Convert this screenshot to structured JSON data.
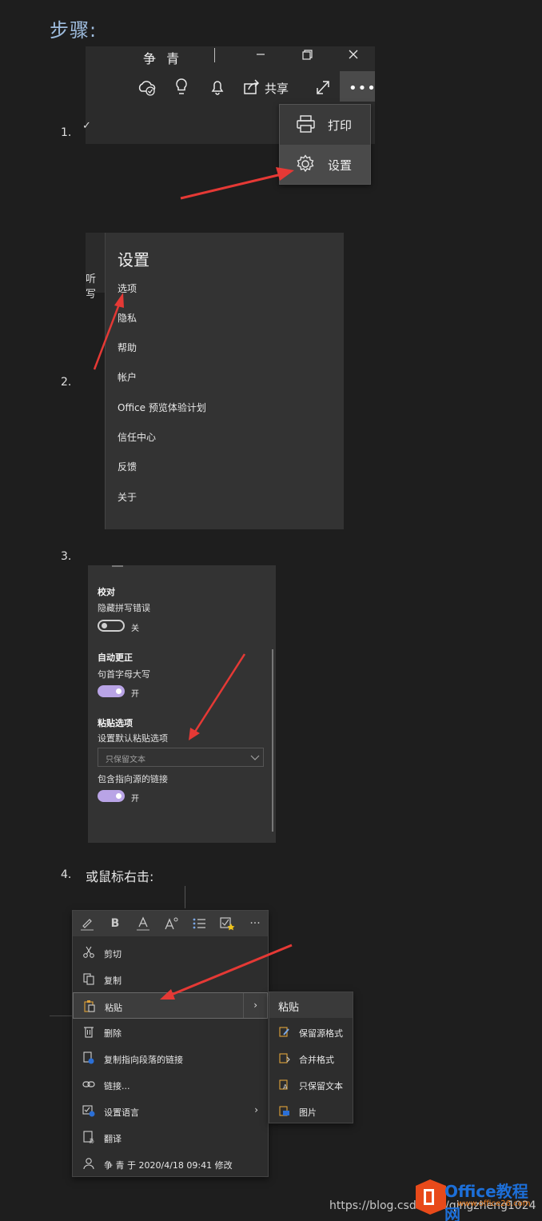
{
  "heading": "步骤:",
  "step_numbers": [
    "1.",
    "2.",
    "3.",
    "4."
  ],
  "step1": {
    "window_title": "争 青",
    "window_controls": [
      "minimize-icon",
      "restore-icon",
      "close-icon"
    ],
    "toolbar_icons": [
      "cloud-sync-icon",
      "lightbulb-icon",
      "bell-icon",
      "share-icon",
      "expand-icon",
      "more-icon"
    ],
    "share_label": "共享",
    "more_label": "•••",
    "fragment": "✓",
    "menu": [
      {
        "label": "打印",
        "icon": "printer-icon"
      },
      {
        "label": "设置",
        "icon": "gear-icon"
      }
    ]
  },
  "step2": {
    "left_fragment": "听写",
    "title": "设置",
    "items": [
      "选项",
      "隐私",
      "帮助",
      "帐户",
      "Office 预览体验计划",
      "信任中心",
      "反馈",
      "关于"
    ]
  },
  "step3": {
    "section1": {
      "title": "校对",
      "option": "隐藏拼写错误",
      "state": "关",
      "on": false
    },
    "section2": {
      "title": "自动更正",
      "option": "句首字母大写",
      "state": "开",
      "on": true
    },
    "section3": {
      "title": "粘贴选项",
      "dropdown_label": "设置默认粘贴选项",
      "dropdown_value": "只保留文本",
      "link_option": "包含指向源的链接",
      "link_state": "开",
      "link_on": true
    }
  },
  "step4": {
    "text": "或鼠标右击:",
    "format_bar": [
      "highlight-icon",
      "bold-icon",
      "font-color-icon",
      "font-size-icon",
      "bullet-list-icon",
      "styles-icon",
      "more-icon"
    ],
    "items": [
      {
        "label": "剪切",
        "icon": "scissors-icon"
      },
      {
        "label": "复制",
        "icon": "copy-icon"
      },
      {
        "label": "粘贴",
        "icon": "paste-icon",
        "submenu": true,
        "selected": true
      },
      {
        "label": "删除",
        "icon": "trash-icon"
      },
      {
        "label": "复制指向段落的链接",
        "icon": "link-copy-icon"
      },
      {
        "label": "链接...",
        "icon": "link-icon"
      },
      {
        "label": "设置语言",
        "icon": "language-icon",
        "submenu": true
      },
      {
        "label": "翻译",
        "icon": "translate-icon"
      },
      {
        "label": "争 青 于 2020/4/18 09:41 修改",
        "icon": "person-icon"
      }
    ],
    "paste_submenu": {
      "title": "粘贴",
      "items": [
        {
          "label": "保留源格式",
          "icon": "paste-keep-source-icon"
        },
        {
          "label": "合并格式",
          "icon": "paste-merge-icon"
        },
        {
          "label": "只保留文本",
          "icon": "paste-text-only-icon"
        },
        {
          "label": "图片",
          "icon": "paste-picture-icon"
        }
      ]
    }
  },
  "watermark": {
    "url": "https://blog.csdn.net/qingzheng1024",
    "brand": "Office教程网",
    "brand_sub": "www.office26.com"
  },
  "colors": {
    "background": "#1e1e1e",
    "heading": "#9fbddf",
    "toggle_on": "#b9a4e6",
    "arrow": "#e53935",
    "brand_blue": "#1d6fd8",
    "brand_orange": "#e87a1c"
  }
}
